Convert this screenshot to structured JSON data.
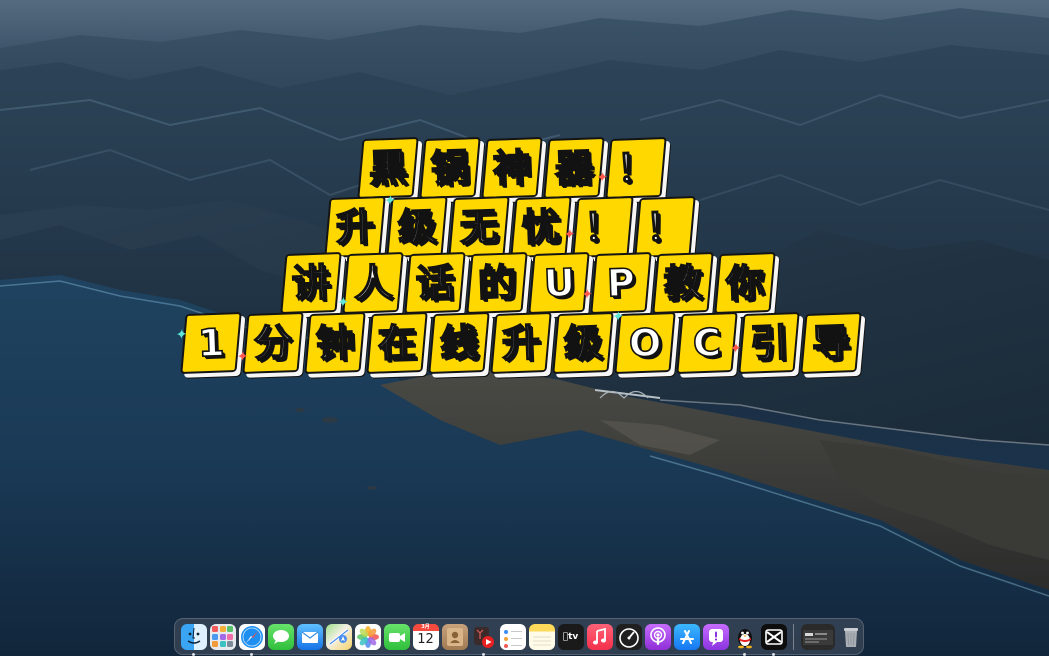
{
  "title_overlay": {
    "lines": [
      [
        "黑",
        "锅",
        "神",
        "器",
        "！"
      ],
      [
        "升",
        "级",
        "无",
        "忧",
        "！",
        "！"
      ],
      [
        "讲",
        "人",
        "话",
        "的",
        "U",
        "P",
        "教",
        "你"
      ],
      [
        "1",
        "分",
        "钟",
        "在",
        "线",
        "升",
        "级",
        "O",
        "C",
        "引",
        "导"
      ]
    ]
  },
  "dock": {
    "apps": [
      {
        "name": "Finder",
        "icon": "finder-icon",
        "running": true
      },
      {
        "name": "Launchpad",
        "icon": "launchpad-icon",
        "running": false
      },
      {
        "name": "Safari",
        "icon": "compass-icon",
        "running": true
      },
      {
        "name": "Messages",
        "icon": "speech-bubble-icon",
        "running": false
      },
      {
        "name": "Mail",
        "icon": "envelope-icon",
        "running": false
      },
      {
        "name": "Maps",
        "icon": "map-icon",
        "running": false
      },
      {
        "name": "Photos",
        "icon": "photos-flower-icon",
        "running": false
      },
      {
        "name": "FaceTime",
        "icon": "video-camera-icon",
        "running": false
      },
      {
        "name": "Calendar",
        "icon": "calendar-icon",
        "month": "3月",
        "day": "12",
        "running": false
      },
      {
        "name": "Contacts",
        "icon": "contact-card-icon",
        "running": false
      },
      {
        "name": "Video Player",
        "icon": "play-badge-icon",
        "running": true
      },
      {
        "name": "Reminders",
        "icon": "checklist-icon",
        "running": false
      },
      {
        "name": "Notes",
        "icon": "notepad-icon",
        "running": false
      },
      {
        "name": "TV",
        "icon": "apple-tv-icon",
        "label": "tv",
        "running": false
      },
      {
        "name": "Music",
        "icon": "music-note-icon",
        "running": false
      },
      {
        "name": "Speedometer",
        "icon": "gauge-icon",
        "running": false
      },
      {
        "name": "Podcasts",
        "icon": "podcast-icon",
        "running": false
      },
      {
        "name": "App Store",
        "icon": "app-store-icon",
        "running": false
      },
      {
        "name": "Feedback Assistant",
        "icon": "exclamation-bubble-icon",
        "running": false
      },
      {
        "name": "QQ",
        "icon": "penguin-icon",
        "running": true
      },
      {
        "name": "CapCut",
        "icon": "capcut-icon",
        "running": true
      }
    ],
    "right_items": [
      {
        "name": "Minimized Window",
        "icon": "window-thumbnail-icon"
      },
      {
        "name": "Trash",
        "icon": "trash-icon"
      }
    ]
  },
  "colors": {
    "tile_fill": "#ffd800",
    "tile_outline": "#141414",
    "glyph_fill": "#ffffff",
    "sea": "#1a3550",
    "dock_bg": "rgba(72,82,96,0.55)"
  }
}
